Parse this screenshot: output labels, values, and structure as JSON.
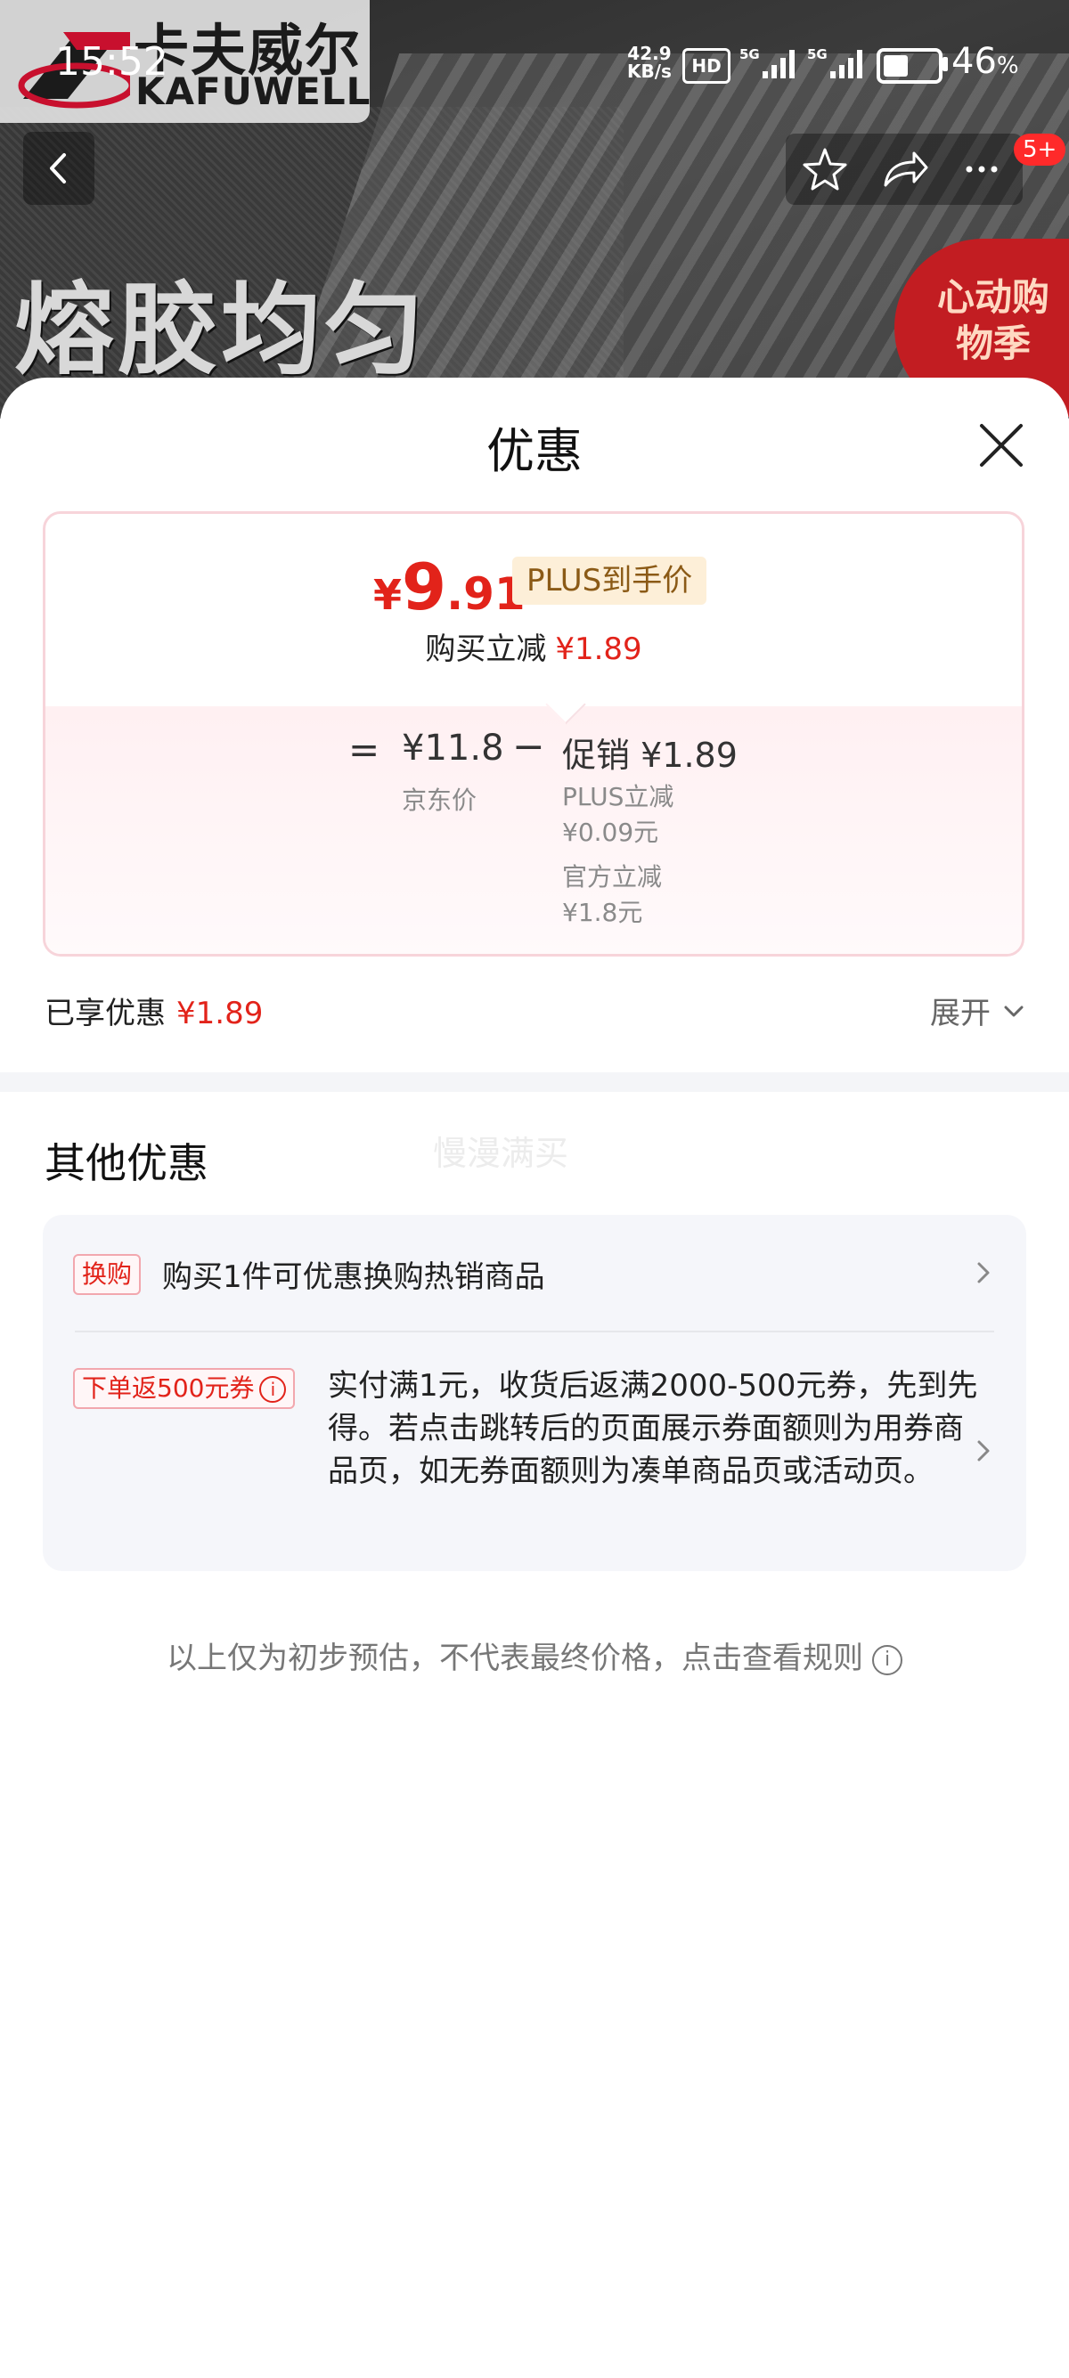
{
  "status_bar": {
    "time": "15:52",
    "net_speed_value": "42.9",
    "net_speed_unit": "KB/s",
    "hd_label": "HD",
    "signal1_label": "5G",
    "signal2_label": "5G",
    "battery_percent": "46",
    "battery_unit": "%",
    "battery_level": 0.46
  },
  "background": {
    "brand_cn": "卡夫威尔",
    "brand_en": "KAFUWELL",
    "headline": "熔胶均匀",
    "promo_badge": "心动购物季",
    "nav_badge": "5+"
  },
  "sheet": {
    "title": "优惠",
    "price": {
      "currency": "¥",
      "integer": "9",
      "decimal": ".91",
      "tag": "PLUS到手价",
      "reduce_label": "购买立减",
      "reduce_value": "¥1.89"
    },
    "breakdown": {
      "equals": "=",
      "jd_price": "¥11.8",
      "jd_label": "京东价",
      "minus": "−",
      "promo_label": "促销",
      "promo_value": "¥1.89",
      "items": [
        {
          "label": "PLUS立减",
          "value": "¥0.09元"
        },
        {
          "label": "官方立减",
          "value": "¥1.8元"
        }
      ]
    },
    "enjoyed_label": "已享优惠",
    "enjoyed_value": "¥1.89",
    "expand_label": "展开",
    "other_title": "其他优惠",
    "watermark": "慢漫满买",
    "offers": [
      {
        "tag": "换购",
        "text": "购买1件可优惠换购热销商品"
      },
      {
        "tag": "下单返500元券",
        "text": "实付满1元，收货后返满2000-500元券，先到先得。若点击跳转后的页面展示券面额则为用券商品页，如无券面额则为凑单商品页或活动页。"
      }
    ],
    "footnote": "以上仅为初步预估，不代表最终价格，点击查看规则"
  },
  "colors": {
    "accent_red": "#e2231a",
    "plus_tag_bg": "#fdefd8",
    "plus_tag_text": "#8b5a16",
    "card_border": "#f7d4da",
    "offer_bg": "#f5f6fa"
  }
}
